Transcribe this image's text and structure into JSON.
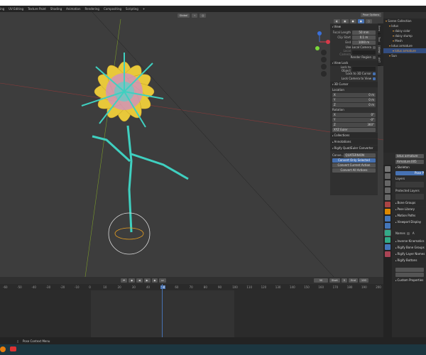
{
  "workspace_tabs": [
    "ing",
    "UV Editing",
    "Texture Paint",
    "Shading",
    "Animation",
    "Rendering",
    "Compositing",
    "Scripting",
    "+"
  ],
  "viewport_header": {
    "orientation": "Global",
    "pose_options": "Pose Options"
  },
  "npanel": {
    "tabs": [
      "Item",
      "Tool",
      "View",
      "ANT"
    ],
    "view": {
      "title": "View",
      "focal_length_label": "Focal Length",
      "focal_length": "50 mm",
      "clip_start_label": "Clip Start",
      "clip_start": "0.1 m",
      "clip_end_label": "End",
      "clip_end": "1000 m",
      "use_local_camera": "Use Local Camera",
      "local_camera": "Local Camera",
      "render_region": "Render Region"
    },
    "view_lock": {
      "title": "View Lock",
      "lock_to_object": "Lock to Object",
      "lock_to_cursor": "Lock to 3D Cursor",
      "lock_camera": "Lock Camera to View"
    },
    "cursor": {
      "title": "3D Cursor",
      "location": "Location",
      "loc": [
        [
          "X",
          "0 m"
        ],
        [
          "Y",
          "0 m"
        ],
        [
          "Z",
          "0 m"
        ]
      ],
      "rotation": "Rotation",
      "rot": [
        [
          "X",
          "0°"
        ],
        [
          "Y",
          "-0°"
        ],
        [
          "Z",
          "360°"
        ]
      ],
      "mode": "XYZ Euler"
    },
    "collections": "Collections",
    "annotations": "Annotations",
    "rigify": "Rigify Quat/Euler Converter",
    "convert_label": "Conve...",
    "convert_value": "QUATERNION",
    "btn_selected": "Convert Only Selected",
    "btn_current": "Convert Current Action",
    "btn_all": "Convert All Actions"
  },
  "outliner": {
    "items": [
      {
        "label": "Scene Collection",
        "indent": 0
      },
      {
        "label": "lotus",
        "indent": 1
      },
      {
        "label": "daisy color",
        "indent": 2
      },
      {
        "label": "daisy stump",
        "indent": 2
      },
      {
        "label": "Mesh",
        "indent": 2
      },
      {
        "label": "lotus armature",
        "indent": 1
      },
      {
        "label": "lotus armature",
        "indent": 2,
        "selected": true
      },
      {
        "label": "Sun",
        "indent": 1
      }
    ]
  },
  "properties": {
    "object": "lotus armature",
    "data": "Armature.005",
    "skeleton": "Skeleton",
    "pose_position": "Pose P",
    "layers": "Layers",
    "protected_layers": "Protected Layers",
    "panels": [
      "Bone Groups",
      "Pose Library",
      "Motion Paths",
      "Viewport Display"
    ],
    "names": "Names",
    "axes": "A",
    "panels2": [
      "Inverse Kinematics",
      "Rigify Bone Groups",
      "Rigify Layer Names",
      "Rigify Buttons"
    ],
    "custom_properties": "Custom Properties"
  },
  "timeline": {
    "current_frame": "50",
    "start_label": "Start",
    "start": "0",
    "end_label": "End",
    "end": "100",
    "ticks": [
      "-60",
      "-50",
      "-40",
      "-30",
      "-20",
      "-10",
      "0",
      "10",
      "20",
      "30",
      "40",
      "50",
      "60",
      "70",
      "80",
      "90",
      "100",
      "110",
      "120",
      "130",
      "140",
      "150",
      "160",
      "170",
      "180",
      "190",
      "200"
    ]
  },
  "status": {
    "context_menu": "Pose Context Menu"
  }
}
